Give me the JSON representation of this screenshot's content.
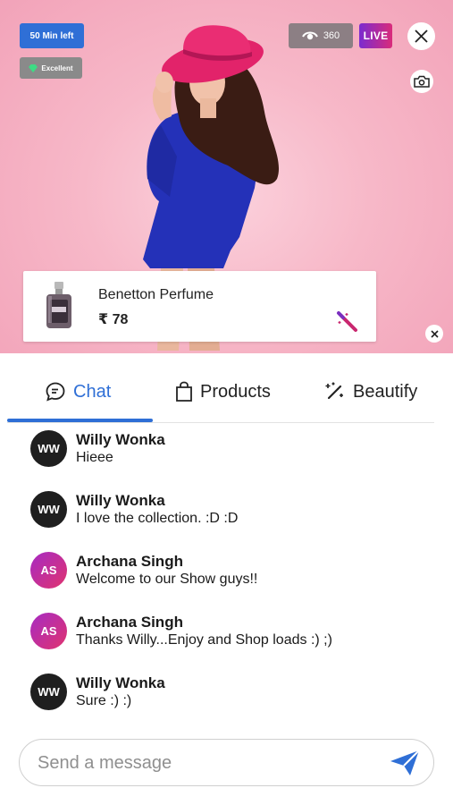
{
  "stream": {
    "time_left": "50 Min left",
    "quality": "Excellent",
    "viewers": "360",
    "live_label": "LIVE"
  },
  "product": {
    "name": "Benetton Perfume",
    "price": "₹ 78"
  },
  "tabs": [
    {
      "label": "Chat",
      "icon": "chat-bubble-icon",
      "active": true
    },
    {
      "label": "Products",
      "icon": "shopping-bag-icon",
      "active": false
    },
    {
      "label": "Beautify",
      "icon": "magic-wand-icon",
      "active": false
    }
  ],
  "messages": [
    {
      "initials": "WW",
      "name": "Willy Wonka",
      "text": "Hieee"
    },
    {
      "initials": "WW",
      "name": "Willy Wonka",
      "text": "I love the collection. :D :D"
    },
    {
      "initials": "AS",
      "name": "Archana Singh",
      "text": "Welcome to our Show guys!!"
    },
    {
      "initials": "AS",
      "name": "Archana Singh",
      "text": "Thanks Willy...Enjoy and Shop loads :) ;)"
    },
    {
      "initials": "WW",
      "name": "Willy Wonka",
      "text": "Sure :) :)"
    }
  ],
  "composer": {
    "placeholder": "Send a message"
  },
  "colors": {
    "accent": "#2f6fd6",
    "live_gradient_start": "#7b2bd0",
    "live_gradient_end": "#d92b7a",
    "hero_background": "#f7b8c8"
  }
}
